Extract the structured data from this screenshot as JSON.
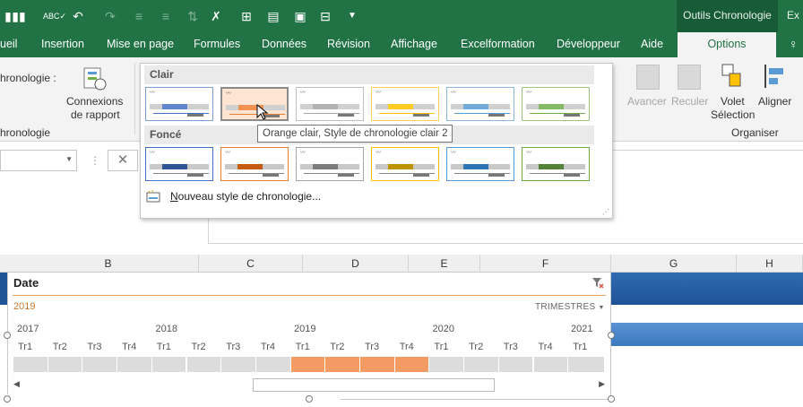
{
  "app": {
    "ribbon_context": "Outils Chronologie",
    "ribbon_context_next": "Ex"
  },
  "tabs": [
    "ueil",
    "Insertion",
    "Mise en page",
    "Formules",
    "Données",
    "Révision",
    "Affichage",
    "Excelformation",
    "Développeur",
    "Aide",
    "Options"
  ],
  "ribbon": {
    "timeline_caption_label": "hronologie :",
    "report_connections": [
      "Connexions",
      "de rapport"
    ],
    "group_left": "hronologie",
    "forward": "Avancer",
    "backward": "Reculer",
    "selection_pane": [
      "Volet",
      "Sélection"
    ],
    "align": "Aligner",
    "group_arrange": "Organiser"
  },
  "styles": {
    "light_header": "Clair",
    "dark_header": "Foncé",
    "new_style": "Nouveau style de chronologie...",
    "tooltip": "Orange clair, Style de chronologie clair 2",
    "colors": [
      "#4472c4",
      "#ed7d31",
      "#a5a5a5",
      "#ffc000",
      "#5b9bd5",
      "#70ad47"
    ],
    "selected_index": 1
  },
  "formula": {
    "cancel_symbol": "✕"
  },
  "columns": [
    "B",
    "C",
    "D",
    "E",
    "F",
    "G",
    "H"
  ],
  "timeline": {
    "title": "Date",
    "year_label": "2019",
    "level": "TRIMESTRES",
    "years": [
      "2017",
      "2018",
      "2019",
      "2020",
      "2021"
    ],
    "quarters": [
      "Tr1",
      "Tr2",
      "Tr3",
      "Tr4",
      "Tr1",
      "Tr2",
      "Tr3",
      "Tr4",
      "Tr1",
      "Tr2",
      "Tr3",
      "Tr4",
      "Tr1",
      "Tr2",
      "Tr3",
      "Tr4",
      "Tr1"
    ],
    "selected_quarters": [
      8,
      9,
      10,
      11
    ]
  }
}
